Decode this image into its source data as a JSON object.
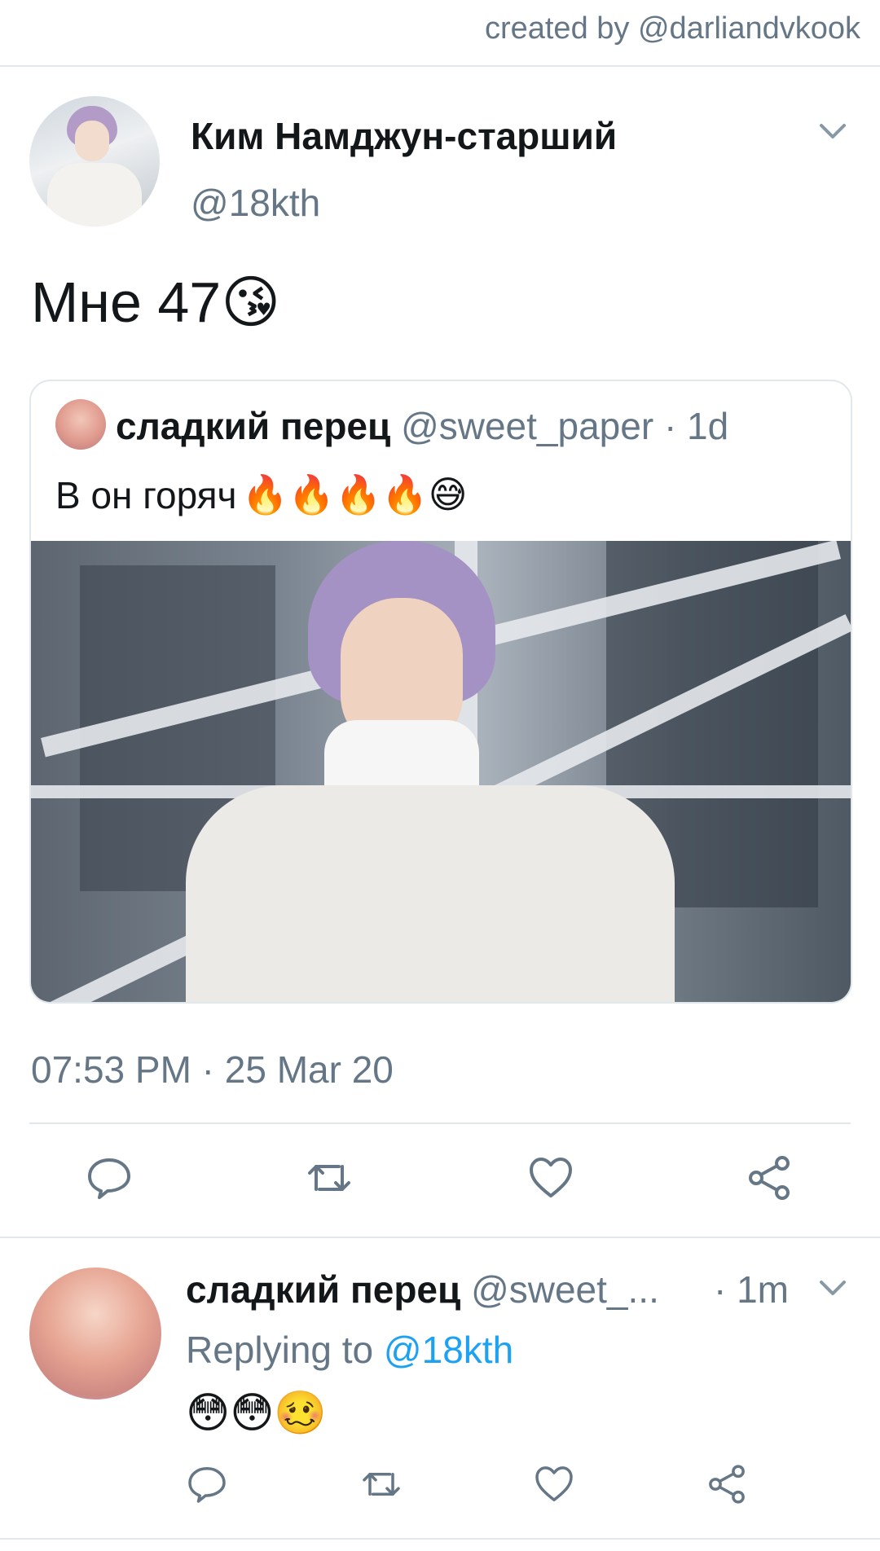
{
  "watermark": "created by @darliandvkook",
  "tweet": {
    "author_name": "Ким Намджун-старший",
    "author_handle": "@18kth",
    "text": "Мне 47",
    "text_emoji": "😘",
    "timestamp": "07:53 PM · 25 Mar 20"
  },
  "quote": {
    "name": "сладкий перец",
    "handle": "@sweet_paper",
    "time": "· 1d",
    "text": "В он горяч",
    "emojis": "🔥🔥🔥🔥😅"
  },
  "actions": [
    "reply-icon",
    "retweet-icon",
    "like-icon",
    "share-icon"
  ],
  "reply": {
    "name": "сладкий перец",
    "handle": "@sweet_...",
    "time": "· 1m",
    "replying_prefix": "Replying to",
    "replying_handle": "@18kth",
    "emojis": "😳😳🥴"
  },
  "colors": {
    "text_primary": "#14171a",
    "text_secondary": "#657786",
    "link": "#1da1f2",
    "border": "#e1e8ed"
  }
}
